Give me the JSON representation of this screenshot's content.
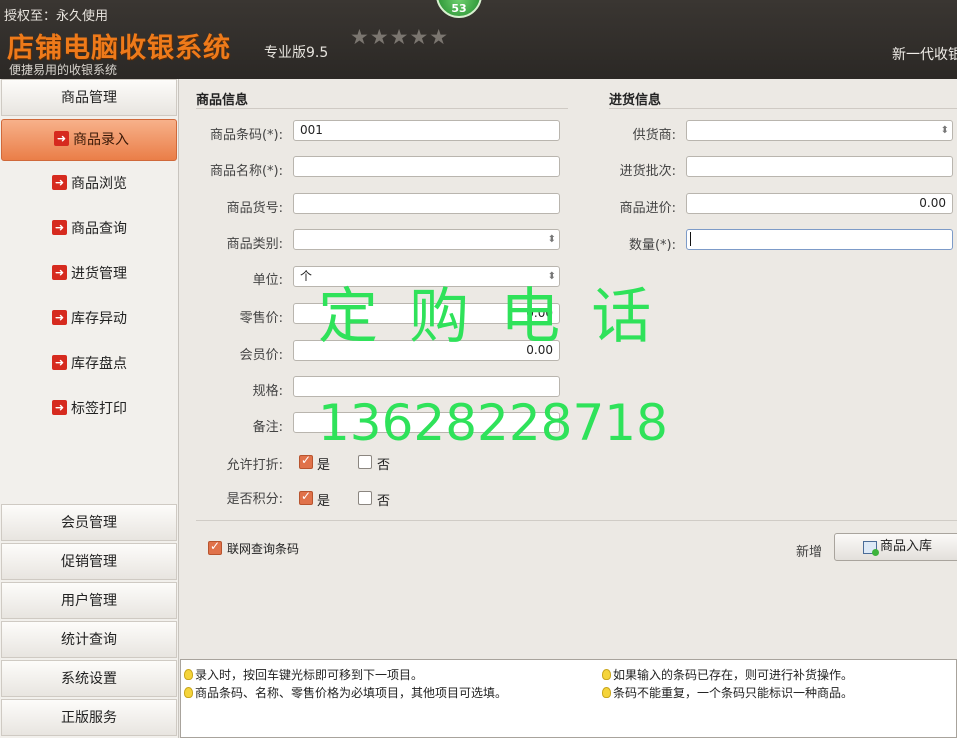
{
  "header": {
    "license": "授权至：永久使用",
    "badge": "53",
    "title": "店铺电脑收银系统",
    "edition": "专业版9.5",
    "stars": "★★★★★",
    "tagline": "便捷易用的收银系统",
    "slogan": "新一代收银"
  },
  "sidebar": {
    "top_category": "商品管理",
    "items": [
      {
        "label": "商品录入",
        "active": true
      },
      {
        "label": "商品浏览"
      },
      {
        "label": "商品查询"
      },
      {
        "label": "进货管理"
      },
      {
        "label": "库存异动"
      },
      {
        "label": "库存盘点"
      },
      {
        "label": "标签打印"
      }
    ],
    "bottom_categories": [
      "会员管理",
      "促销管理",
      "用户管理",
      "统计查询",
      "系统设置",
      "正版服务"
    ]
  },
  "product_info": {
    "title": "商品信息",
    "barcode_label": "商品条码(*):",
    "barcode_value": "001",
    "name_label": "商品名称(*):",
    "name_value": "",
    "item_no_label": "商品货号:",
    "item_no_value": "",
    "category_label": "商品类别:",
    "category_value": "",
    "unit_label": "单位:",
    "unit_value": "个",
    "retail_label": "零售价:",
    "retail_value": "0.00",
    "member_label": "会员价:",
    "member_value": "0.00",
    "spec_label": "规格:",
    "spec_value": "",
    "note_label": "备注:",
    "note_value": "",
    "discount_label": "允许打折:",
    "points_label": "是否积分:",
    "yes": "是",
    "no": "否"
  },
  "purchase_info": {
    "title": "进货信息",
    "supplier_label": "供货商:",
    "supplier_value": "",
    "batch_label": "进货批次:",
    "batch_value": "",
    "cost_label": "商品进价:",
    "cost_value": "0.00",
    "qty_label": "数量(*):",
    "qty_value": ""
  },
  "footer": {
    "online_lookup": "联网查询条码",
    "new_link": "新增",
    "save_button": "商品入库"
  },
  "watermark": {
    "line1": "定 购 电 话",
    "line2": "13628228718"
  },
  "tips": [
    "录入时，按回车键光标即可移到下一项目。",
    "商品条码、名称、零售价格为必填项目，其他项目可选填。",
    "如果输入的条码已存在，则可进行补货操作。",
    "条码不能重复，一个条码只能标识一种商品。"
  ],
  "colors": {
    "accent": "#ea7e48",
    "watermark": "#2fe25a",
    "header_bg": "#2b2825",
    "logo": "#ee7a1a"
  }
}
